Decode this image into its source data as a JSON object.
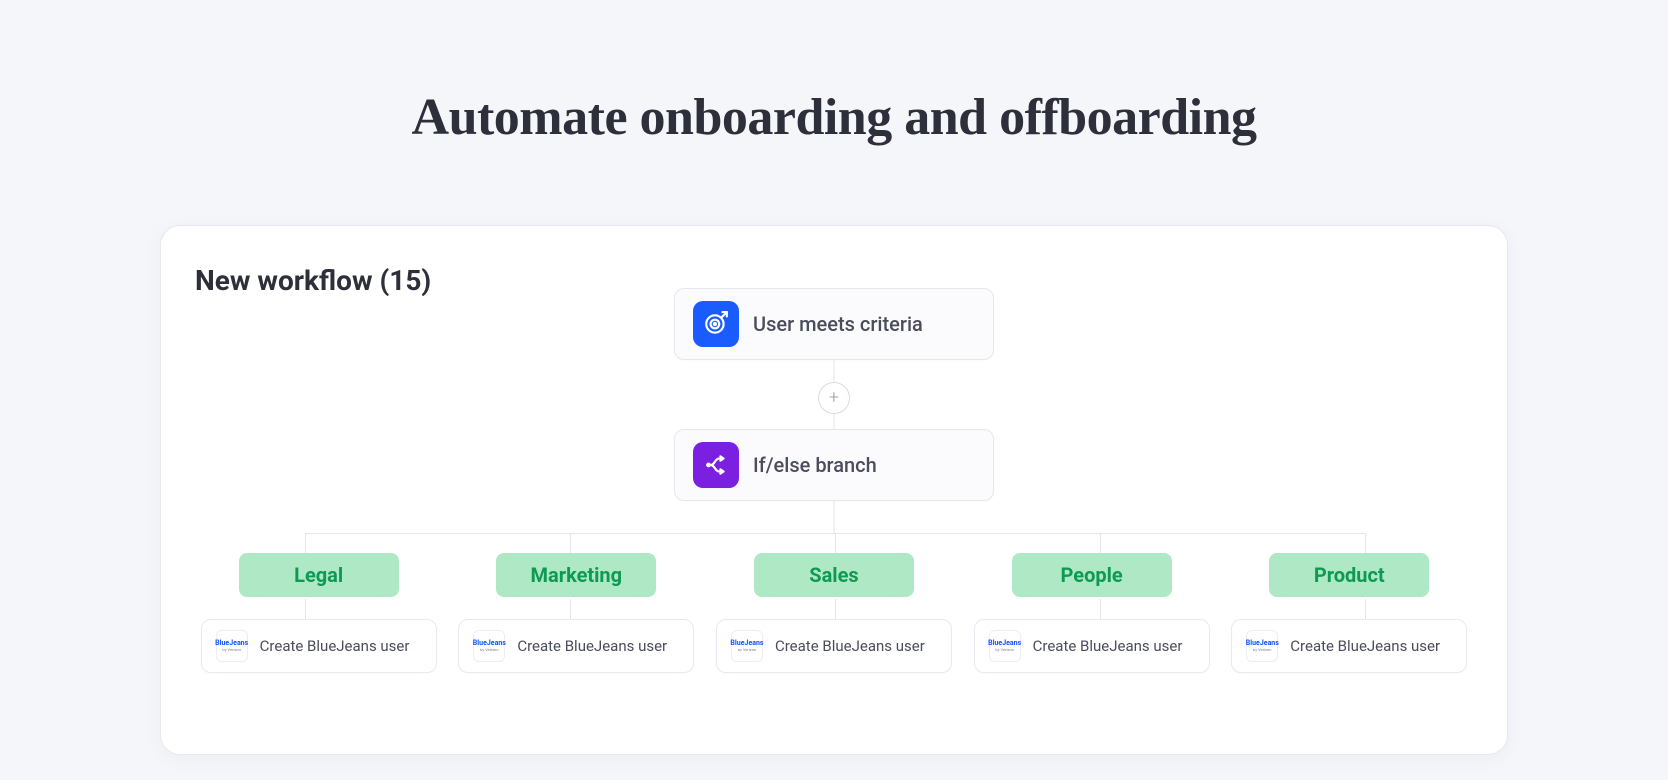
{
  "title": "Automate onboarding and offboarding",
  "workflow": {
    "name": "New workflow (15)",
    "trigger": {
      "label": "User meets criteria"
    },
    "condition": {
      "label": "If/else branch"
    },
    "branches": [
      {
        "name": "Legal",
        "action": "Create BlueJeans user",
        "provider": "BlueJeans"
      },
      {
        "name": "Marketing",
        "action": "Create BlueJeans user",
        "provider": "BlueJeans"
      },
      {
        "name": "Sales",
        "action": "Create BlueJeans user",
        "provider": "BlueJeans"
      },
      {
        "name": "People",
        "action": "Create BlueJeans user",
        "provider": "BlueJeans"
      },
      {
        "name": "Product",
        "action": "Create BlueJeans user",
        "provider": "BlueJeans"
      }
    ]
  },
  "colors": {
    "accentBlue": "#1a5cff",
    "accentPurple": "#7b1fe0",
    "tagBg": "#aee8c4",
    "tagText": "#0e9a52"
  }
}
